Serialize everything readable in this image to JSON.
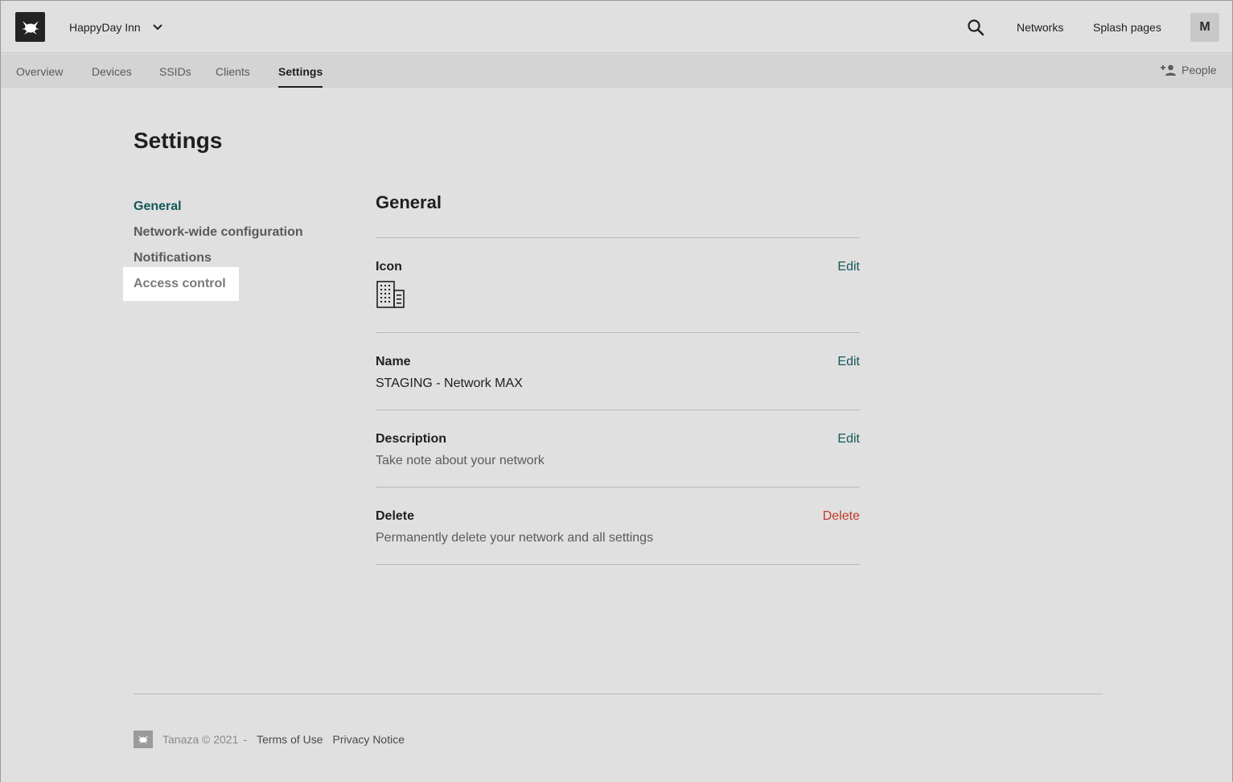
{
  "header": {
    "network_name": "HappyDay Inn",
    "links": {
      "networks": "Networks",
      "splash_pages": "Splash pages"
    },
    "avatar_initial": "M"
  },
  "tabs": [
    {
      "label": "Overview"
    },
    {
      "label": "Devices"
    },
    {
      "label": "SSIDs"
    },
    {
      "label": "Clients"
    },
    {
      "label": "Settings",
      "active": true
    }
  ],
  "people_label": "People",
  "page": {
    "title": "Settings"
  },
  "side_nav": [
    {
      "label": "General",
      "active": true
    },
    {
      "label": "Network-wide configuration"
    },
    {
      "label": "Notifications"
    },
    {
      "label": "Access control",
      "hovered": true
    }
  ],
  "section": {
    "title": "General",
    "rows": {
      "icon": {
        "label": "Icon",
        "action": "Edit",
        "icon_name": "building-icon"
      },
      "name": {
        "label": "Name",
        "value": "STAGING - Network MAX",
        "action": "Edit"
      },
      "description": {
        "label": "Description",
        "value": "Take note about your network",
        "action": "Edit"
      },
      "delete": {
        "label": "Delete",
        "value": "Permanently delete your network and all settings",
        "action": "Delete"
      }
    }
  },
  "footer": {
    "copyright": "Tanaza © 2021",
    "separator": "-",
    "terms": "Terms of Use",
    "privacy": "Privacy Notice"
  },
  "colors": {
    "accent": "#14585a",
    "danger": "#c0392b",
    "background": "#e0e0e0",
    "tabbar": "#d4d4d4"
  }
}
